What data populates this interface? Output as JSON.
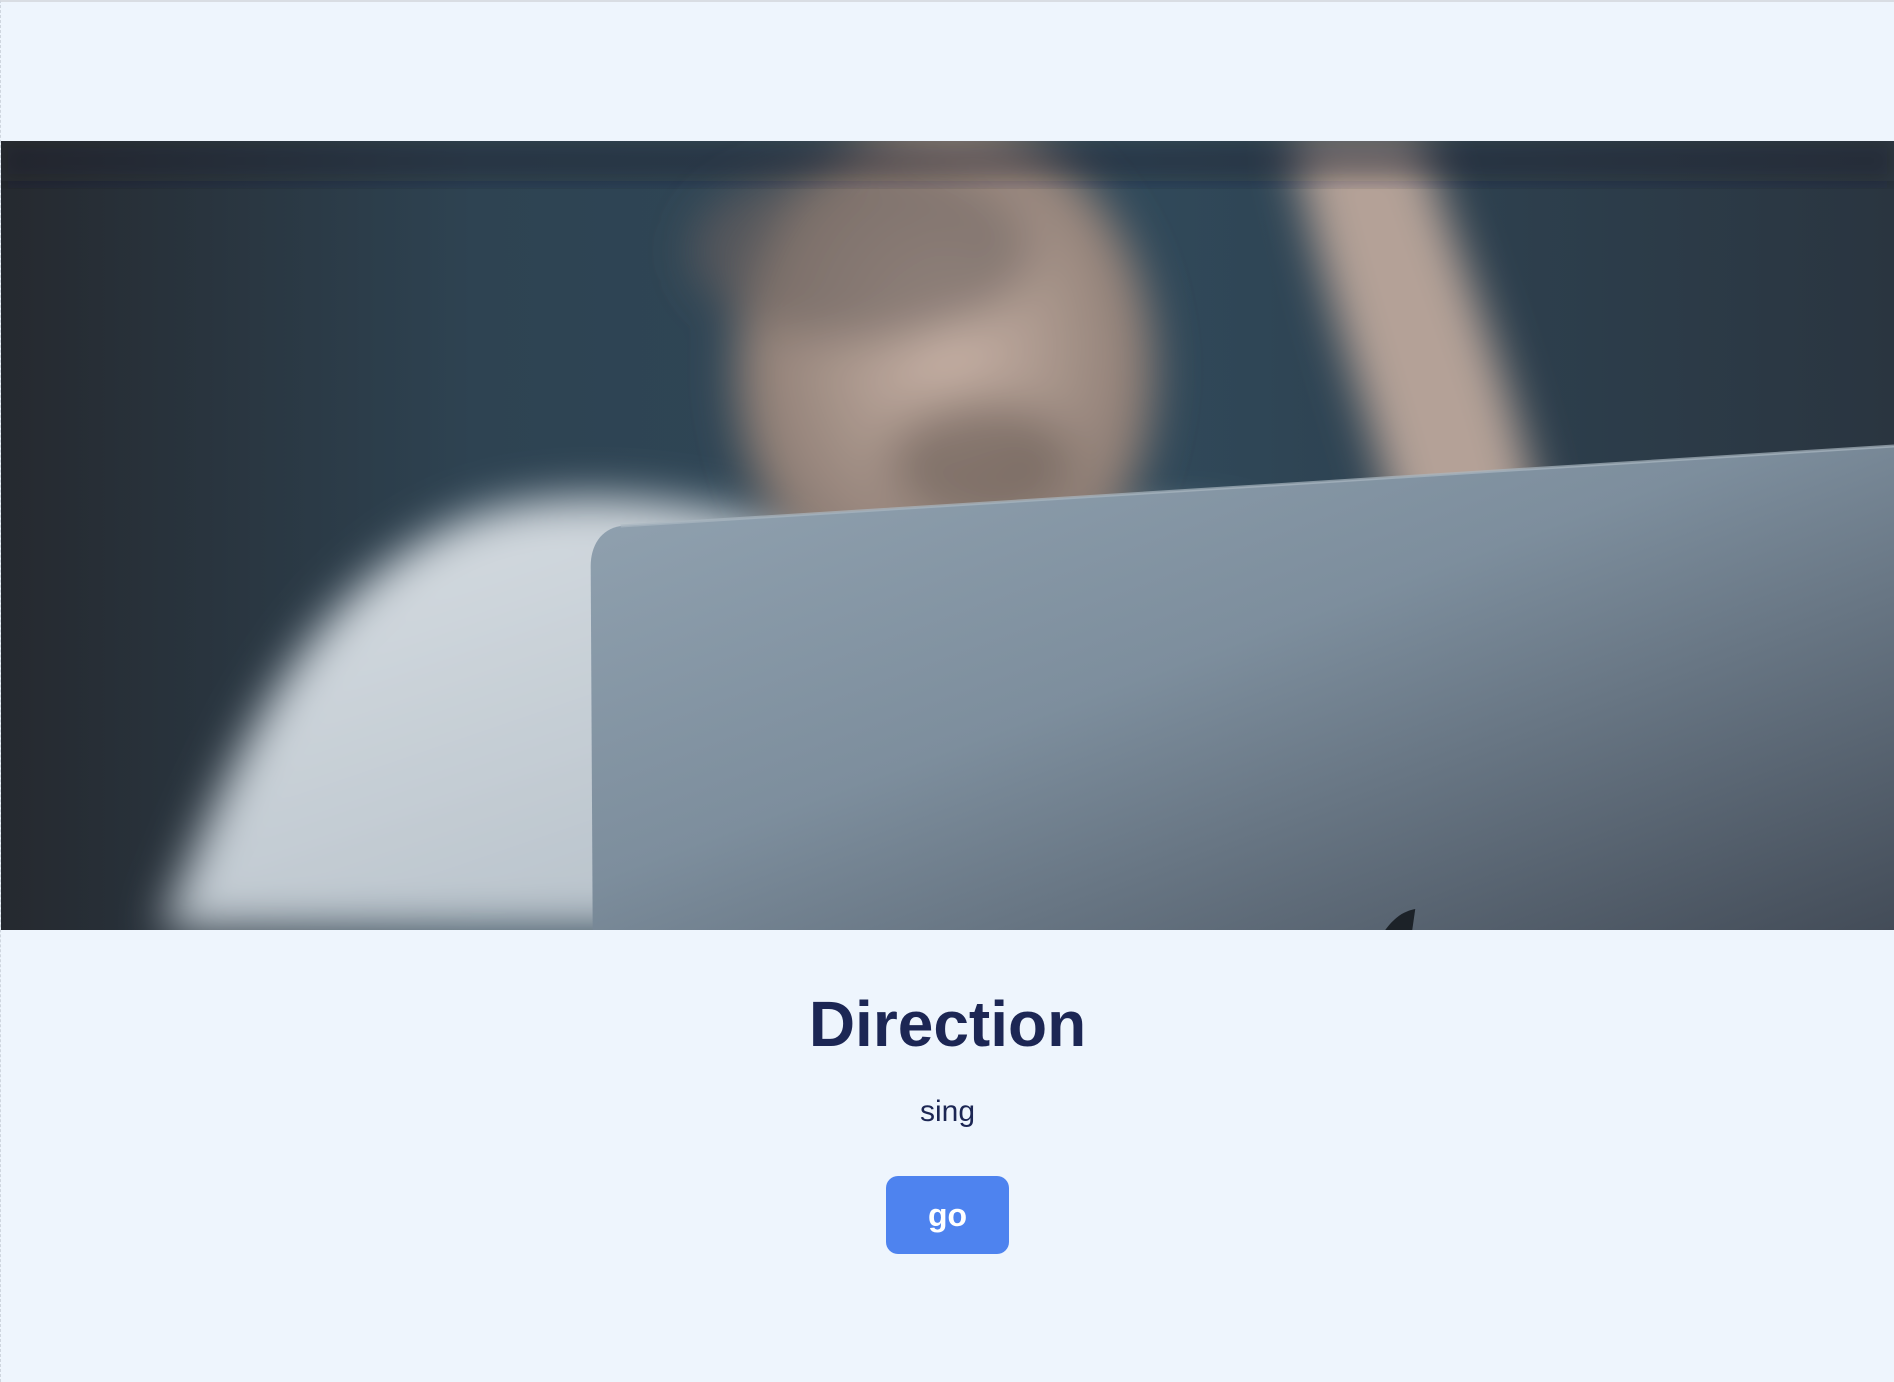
{
  "hero": {
    "image_description_icon": "person-at-laptop-photo"
  },
  "main": {
    "title": "Direction",
    "subtitle": "sing",
    "button_label": "go"
  },
  "colors": {
    "background": "#eef5fd",
    "title_text": "#1c2654",
    "button_bg": "#4e83ef",
    "button_text": "#ffffff"
  }
}
